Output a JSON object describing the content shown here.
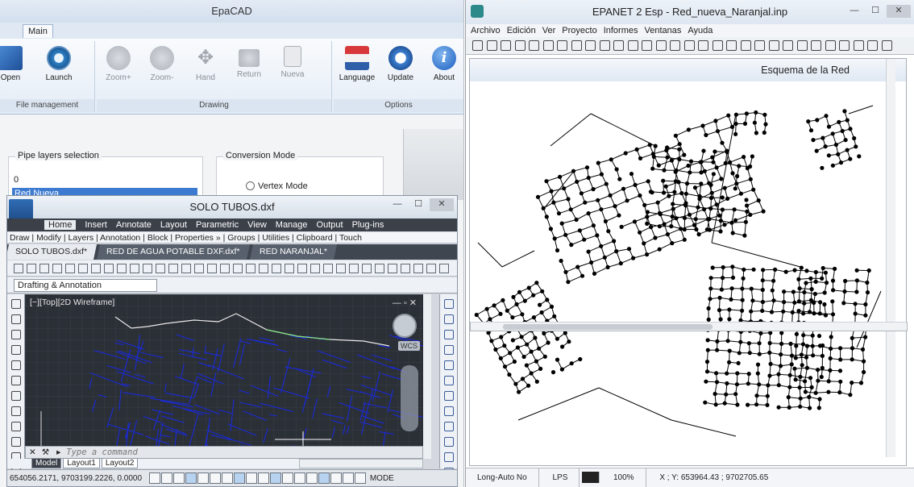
{
  "epacad": {
    "title": "EpaCAD",
    "tab_main": "Main",
    "groups": {
      "file": "File management",
      "drawing": "Drawing",
      "options": "Options"
    },
    "buttons": {
      "open": "Open",
      "launch": "Launch",
      "zoom_in": "Zoom+",
      "zoom_out": "Zoom-",
      "hand": "Hand",
      "return": "Return",
      "nueva": "Nueva",
      "language": "Language",
      "update": "Update",
      "about": "About"
    },
    "pipe_layers_label": "Pipe layers selection",
    "pipe_layers": [
      "0",
      "Red Nueva"
    ],
    "conversion_label": "Conversion Mode",
    "vertex_mode": "Vertex Mode"
  },
  "acad": {
    "title": "SOLO TUBOS.dxf",
    "logo": "CAD",
    "menu": [
      "Home",
      "Insert",
      "Annotate",
      "Layout",
      "Parametric",
      "View",
      "Manage",
      "Output",
      "Plug-ins"
    ],
    "panels": "Draw | Modify | Layers | Annotation | Block | Properties » | Groups | Utilities | Clipboard | Touch",
    "doc_tabs": [
      "SOLO TUBOS.dxf*",
      "RED DE AGUA POTABLE DXF.dxf*",
      "RED NARANJAL*"
    ],
    "workspace": "Drafting & Annotation",
    "viewport_label": "[−][Top][2D Wireframe]",
    "wcs": "WCS",
    "command_placeholder": "Type a command",
    "layout_tabs": [
      "Model",
      "Layout1",
      "Layout2"
    ],
    "coords": "654056.2171, 9703199.2226, 0.0000",
    "mode_label": "MODE"
  },
  "epanet": {
    "title": "EPANET 2 Esp - Red_nueva_Naranjal.inp",
    "menu": [
      "Archivo",
      "Edición",
      "Ver",
      "Proyecto",
      "Informes",
      "Ventanas",
      "Ayuda"
    ],
    "map_title": "Esquema de la Red",
    "status": {
      "autolength": "Long-Auto No",
      "units": "LPS",
      "zoom": "100%",
      "xy": "X ; Y: 653964.43 ; 9702705.65"
    }
  }
}
